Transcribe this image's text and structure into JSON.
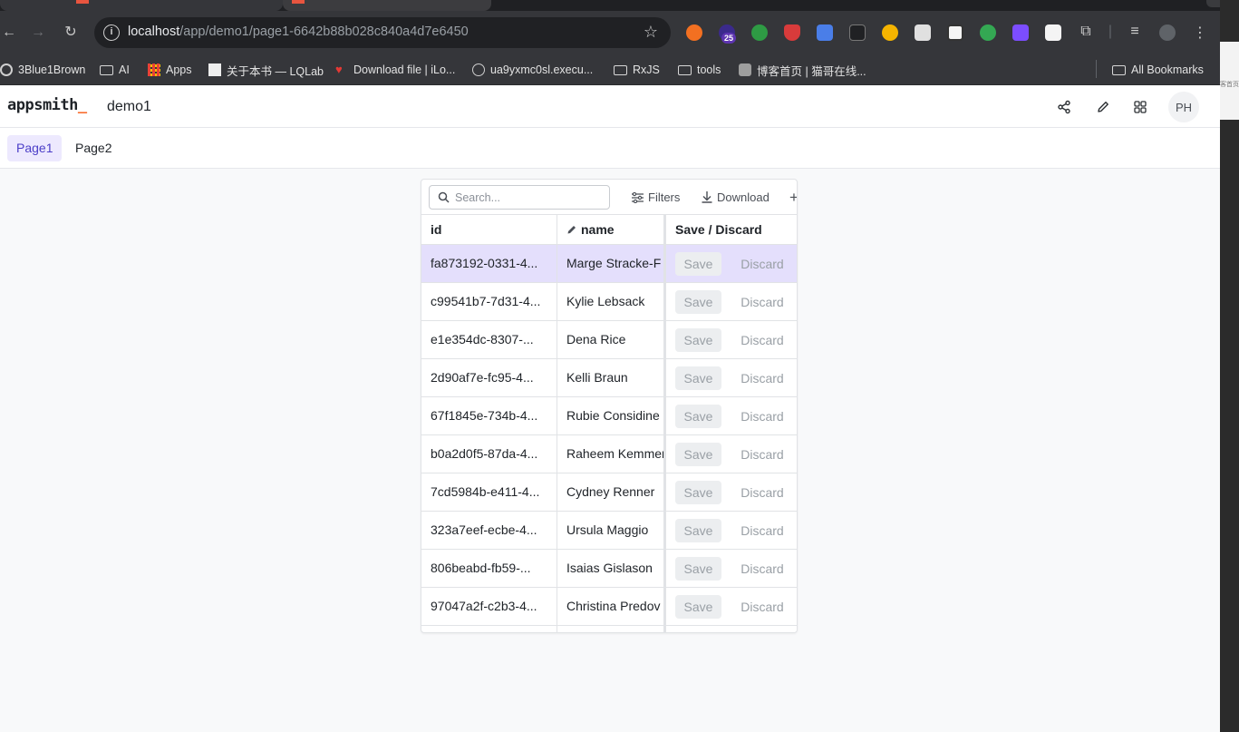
{
  "browser": {
    "url_host": "localhost",
    "url_path": "/app/demo1/page1-6642b88b028c840a4d7e6450",
    "extension_badge": "25",
    "bookmarks": [
      {
        "label": "3Blue1Brown",
        "icon": "circle-icon"
      },
      {
        "label": "AI",
        "icon": "folder-icon"
      },
      {
        "label": "Apps",
        "icon": "apps-grid-icon"
      },
      {
        "label": "关于本书 — LQLab",
        "icon": "site-icon"
      },
      {
        "label": "Download file | iLo...",
        "icon": "heart-icon"
      },
      {
        "label": "ua9yxmc0sl.execu...",
        "icon": "globe-icon"
      },
      {
        "label": "RxJS",
        "icon": "folder-icon"
      },
      {
        "label": "tools",
        "icon": "folder-icon"
      },
      {
        "label": "博客首页 | 猫哥在线...",
        "icon": "site-icon"
      }
    ],
    "all_bookmarks": "All Bookmarks"
  },
  "side_window": {
    "text": "客首页"
  },
  "app": {
    "logo_text": "appsmith",
    "logo_underscore": "_",
    "app_name": "demo1",
    "avatar_initials": "PH",
    "pages": [
      {
        "label": "Page1",
        "active": true
      },
      {
        "label": "Page2",
        "active": false
      }
    ]
  },
  "table": {
    "search_placeholder": "Search...",
    "filters_label": "Filters",
    "download_label": "Download",
    "columns": {
      "id": "id",
      "name": "name",
      "actions": "Save / Discard"
    },
    "save_label": "Save",
    "discard_label": "Discard",
    "rows": [
      {
        "id": "fa873192-0331-4...",
        "name": "Marge Stracke-F",
        "selected": true
      },
      {
        "id": "c99541b7-7d31-4...",
        "name": "Kylie Lebsack",
        "selected": false
      },
      {
        "id": "e1e354dc-8307-...",
        "name": "Dena Rice",
        "selected": false
      },
      {
        "id": "2d90af7e-fc95-4...",
        "name": "Kelli Braun",
        "selected": false
      },
      {
        "id": "67f1845e-734b-4...",
        "name": "Rubie Considine",
        "selected": false
      },
      {
        "id": "b0a2d0f5-87da-4...",
        "name": "Raheem Kemmer",
        "selected": false
      },
      {
        "id": "7cd5984b-e411-4...",
        "name": "Cydney Renner",
        "selected": false
      },
      {
        "id": "323a7eef-ecbe-4...",
        "name": "Ursula Maggio",
        "selected": false
      },
      {
        "id": "806beabd-fb59-...",
        "name": "Isaias Gislason",
        "selected": false
      },
      {
        "id": "97047a2f-c2b3-4...",
        "name": "Christina Predov",
        "selected": false
      }
    ]
  },
  "colors": {
    "accent": "#4c3fc8",
    "selected_row": "#e4dffc",
    "logo_underscore": "#f86a2b"
  }
}
